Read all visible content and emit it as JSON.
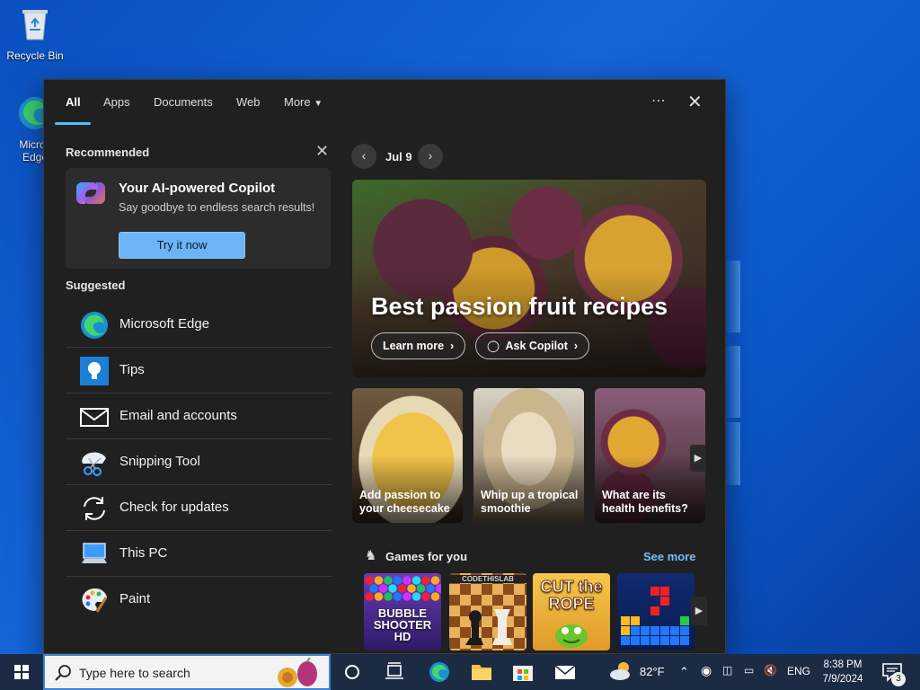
{
  "desktop": {
    "recycle_bin_label": "Recycle Bin",
    "edge_label_line1": "Micros",
    "edge_label_line2": "Edge"
  },
  "search_panel": {
    "tabs": [
      {
        "label": "All",
        "active": true
      },
      {
        "label": "Apps"
      },
      {
        "label": "Documents"
      },
      {
        "label": "Web"
      },
      {
        "label": "More"
      }
    ],
    "more_menu_icon": "ellipsis-icon",
    "close_icon": "close-icon",
    "recommended": {
      "title": "Recommended",
      "copilot_card": {
        "title": "Your AI-powered Copilot",
        "subtitle": "Say goodbye to endless search results!",
        "button_label": "Try it now"
      }
    },
    "suggested": {
      "title": "Suggested",
      "items": [
        {
          "label": "Microsoft Edge",
          "icon": "edge-icon"
        },
        {
          "label": "Tips",
          "icon": "lightbulb-icon"
        },
        {
          "label": "Email and accounts",
          "icon": "envelope-icon"
        },
        {
          "label": "Snipping Tool",
          "icon": "scissors-icon"
        },
        {
          "label": "Check for updates",
          "icon": "refresh-icon"
        },
        {
          "label": "This PC",
          "icon": "computer-icon"
        },
        {
          "label": "Paint",
          "icon": "palette-icon"
        }
      ]
    },
    "highlights": {
      "date": "Jul 9",
      "hero": {
        "title": "Best passion fruit recipes",
        "learn_more": "Learn more",
        "ask_copilot": "Ask Copilot"
      },
      "cards": [
        {
          "caption": "Add passion to your cheesecake"
        },
        {
          "caption": "Whip up a tropical smoothie"
        },
        {
          "caption": "What are its health benefits?"
        }
      ],
      "games": {
        "title": "Games for you",
        "see_more": "See more",
        "tiles": [
          {
            "text": "BUBBLE SHOOTER HD"
          },
          {
            "text": "CODETHISLAB"
          },
          {
            "text": "CUT the ROPE"
          },
          {
            "text": ""
          }
        ]
      }
    }
  },
  "taskbar": {
    "search_placeholder": "Type here to search",
    "weather": "82°F",
    "language": "ENG",
    "time": "8:38 PM",
    "date": "7/9/2024",
    "notification_count": "3"
  },
  "colors": {
    "accent": "#4cc2ff",
    "panel_bg": "#202020",
    "taskbar_bg": "#1c2b44",
    "link": "#74c0ff"
  }
}
